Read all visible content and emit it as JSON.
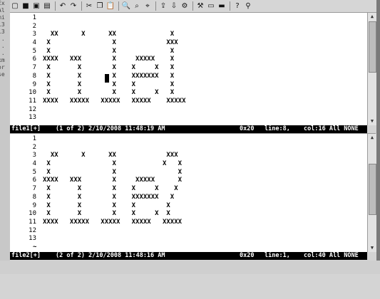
{
  "toolbar": {
    "buttons": [
      {
        "icon": "new-file-icon",
        "glyph": "▢"
      },
      {
        "icon": "save-icon",
        "glyph": "■"
      },
      {
        "icon": "save-all-icon",
        "glyph": "▣"
      },
      {
        "icon": "print-icon",
        "glyph": "▤"
      },
      {
        "icon": "undo-icon",
        "glyph": "↶"
      },
      {
        "icon": "redo-icon",
        "glyph": "↷"
      },
      {
        "icon": "cut-icon",
        "glyph": "✂"
      },
      {
        "icon": "copy-icon",
        "glyph": "❐"
      },
      {
        "icon": "paste-icon",
        "glyph": "📋"
      },
      {
        "icon": "find-icon",
        "glyph": "🔍"
      },
      {
        "icon": "find-next-icon",
        "glyph": "⌕"
      },
      {
        "icon": "find-prev-icon",
        "glyph": "⌖"
      },
      {
        "icon": "load-session-icon",
        "glyph": "⇪"
      },
      {
        "icon": "save-session-icon",
        "glyph": "⇩"
      },
      {
        "icon": "run-script-icon",
        "glyph": "⚙"
      },
      {
        "icon": "make-icon",
        "glyph": "⚒"
      },
      {
        "icon": "shell-icon",
        "glyph": "▭"
      },
      {
        "icon": "ctags-icon",
        "glyph": "▬"
      },
      {
        "icon": "help-icon",
        "glyph": "?"
      },
      {
        "icon": "find-help-icon",
        "glyph": "⚲"
      }
    ]
  },
  "left_fragments": [
    "Ex",
    "Al",
    "mi",
    "",
    "",
    "l3",
    "l3",
    ":.",
    ":.",
    ":.",
    "",
    "",
    "",
    "xm",
    "or",
    "se"
  ],
  "pane1": {
    "lines": [
      {
        "n": "1",
        "t": ""
      },
      {
        "n": "2",
        "t": ""
      },
      {
        "n": "3",
        "t": "  XX      X      XX              X"
      },
      {
        "n": "4",
        "t": " X                X             XXX"
      },
      {
        "n": "5",
        "t": " X                X              X"
      },
      {
        "n": "6",
        "t": "XXXX   XXX        X     XXXXX    X"
      },
      {
        "n": "7",
        "t": " X       X        X    X     X   X"
      },
      {
        "n": "8",
        "t": " X       X        X    XXXXXXX   X"
      },
      {
        "n": "9",
        "t": " X       X        X    X         X"
      },
      {
        "n": "10",
        "t": " X       X        X    X     X   X"
      },
      {
        "n": "11",
        "t": "XXXX   XXXXX   XXXXX   XXXXX    XXXXX"
      },
      {
        "n": "12",
        "t": ""
      },
      {
        "n": "13",
        "t": ""
      }
    ],
    "status": {
      "file": "file1[+]",
      "info": "(1 of 2) 2/10/2008 11:48:19 AM",
      "char": "0x20",
      "line": "line:8,",
      "col": "col:16 All NONE"
    }
  },
  "pane2": {
    "lines": [
      {
        "n": "1",
        "t": ""
      },
      {
        "n": "2",
        "t": ""
      },
      {
        "n": "3",
        "t": "  XX      X      XX             XXX"
      },
      {
        "n": "4",
        "t": " X                X            X   X"
      },
      {
        "n": "5",
        "t": " X                X                X"
      },
      {
        "n": "6",
        "t": "XXXX   XXX        X     XXXXX      X"
      },
      {
        "n": "7",
        "t": " X       X        X    X     X    X"
      },
      {
        "n": "8",
        "t": " X       X        X    XXXXXXX   X"
      },
      {
        "n": "9",
        "t": " X       X        X    X        X"
      },
      {
        "n": "10",
        "t": " X       X        X    X     X  X"
      },
      {
        "n": "11",
        "t": "XXXX   XXXXX   XXXXX   XXXXX   XXXXX"
      },
      {
        "n": "12",
        "t": ""
      },
      {
        "n": "13",
        "t": ""
      }
    ],
    "tilde": "~",
    "status": {
      "file": "file2[+]",
      "info": "(2 of 2) 2/10/2008 11:48:16 AM",
      "char": "0x20",
      "line": "line:1,",
      "col": "col:40 All NONE"
    }
  }
}
